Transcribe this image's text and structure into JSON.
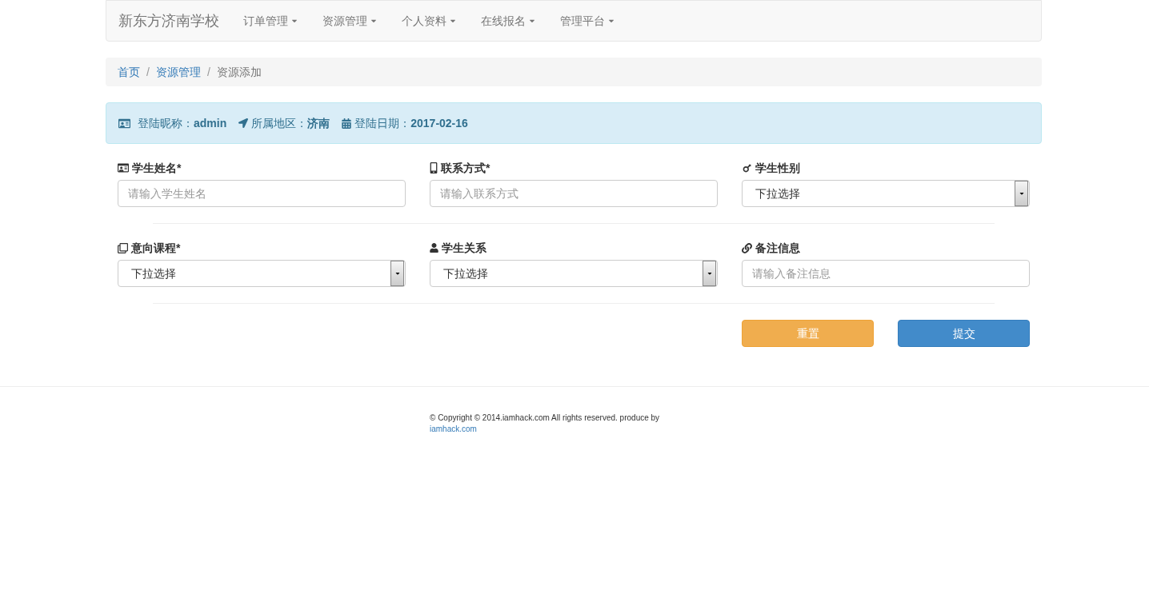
{
  "navbar": {
    "brand": "新东方济南学校",
    "items": [
      {
        "label": "订单管理"
      },
      {
        "label": "资源管理"
      },
      {
        "label": "个人资料"
      },
      {
        "label": "在线报名"
      },
      {
        "label": "管理平台"
      }
    ]
  },
  "breadcrumb": [
    {
      "label": "首页",
      "kind": "link"
    },
    {
      "label": "/",
      "kind": "separator"
    },
    {
      "label": "资源管理",
      "kind": "link"
    },
    {
      "label": "/",
      "kind": "separator"
    },
    {
      "label": "资源添加",
      "kind": "current"
    }
  ],
  "info_bar": [
    {
      "label": "登陆昵称：",
      "value": "admin"
    },
    {
      "label": "所属地区：",
      "value": "济南"
    },
    {
      "label": "登陆日期：",
      "value": "2017-02-16"
    }
  ],
  "form_rows": [
    [
      {
        "label": "学生姓名*",
        "kind": "input",
        "placeholder": "请输入学生姓名"
      },
      {
        "label": "联系方式*",
        "kind": "input",
        "placeholder": "请输入联系方式"
      },
      {
        "label": "学生性别",
        "kind": "select",
        "value": "下拉选择"
      }
    ],
    [
      {
        "label": "意向课程*",
        "kind": "select",
        "value": "下拉选择"
      },
      {
        "label": "学生关系",
        "kind": "select",
        "value": "下拉选择"
      },
      {
        "label": "备注信息",
        "kind": "input",
        "placeholder": "请输入备注信息"
      }
    ]
  ],
  "buttons": [
    {
      "label": "重置",
      "kind": "warning"
    },
    {
      "label": "提交",
      "kind": "primary"
    }
  ],
  "footer": {
    "text": "© Copyright © 2014.iamhack.com All rights reserved. produce by",
    "link": "iamhack.com"
  }
}
